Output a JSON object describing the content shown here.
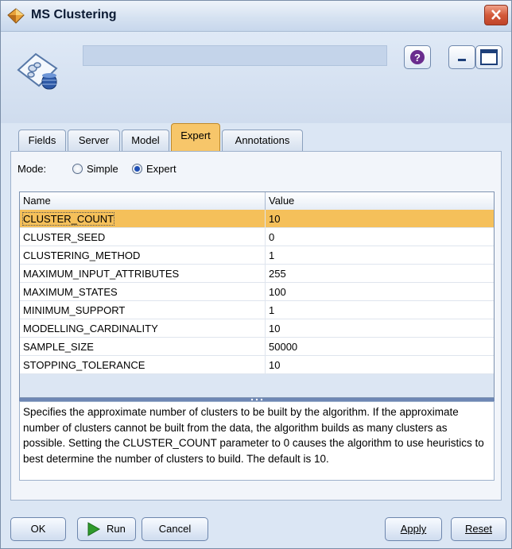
{
  "window": {
    "title": "MS Clustering"
  },
  "tabs": [
    {
      "label": "Fields"
    },
    {
      "label": "Server"
    },
    {
      "label": "Model"
    },
    {
      "label": "Expert"
    },
    {
      "label": "Annotations"
    }
  ],
  "active_tab": "Expert",
  "mode": {
    "label": "Mode:",
    "options": [
      {
        "label": "Simple",
        "checked": false
      },
      {
        "label": "Expert",
        "checked": true
      }
    ]
  },
  "table": {
    "columns": [
      "Name",
      "Value"
    ],
    "rows": [
      {
        "name": "CLUSTER_COUNT",
        "value": "10",
        "selected": true
      },
      {
        "name": "CLUSTER_SEED",
        "value": "0"
      },
      {
        "name": "CLUSTERING_METHOD",
        "value": "1"
      },
      {
        "name": "MAXIMUM_INPUT_ATTRIBUTES",
        "value": "255"
      },
      {
        "name": "MAXIMUM_STATES",
        "value": "100"
      },
      {
        "name": "MINIMUM_SUPPORT",
        "value": "1"
      },
      {
        "name": "MODELLING_CARDINALITY",
        "value": "10"
      },
      {
        "name": "SAMPLE_SIZE",
        "value": "50000"
      },
      {
        "name": "STOPPING_TOLERANCE",
        "value": "10"
      }
    ]
  },
  "description": "Specifies the approximate number of clusters to be built by the algorithm. If the approximate number of clusters cannot be built from the data, the algorithm builds as many clusters as possible. Setting the CLUSTER_COUNT parameter to 0 causes the algorithm to use heuristics to best determine the number of clusters to build.     The default is 10.",
  "buttons": {
    "ok": "OK",
    "run": "Run",
    "cancel": "Cancel",
    "apply": "Apply",
    "reset": "Reset"
  },
  "colors": {
    "accent_tab": "#f7c66a",
    "selected_row": "#f5c05a",
    "help_icon": "#6a2c8e"
  }
}
